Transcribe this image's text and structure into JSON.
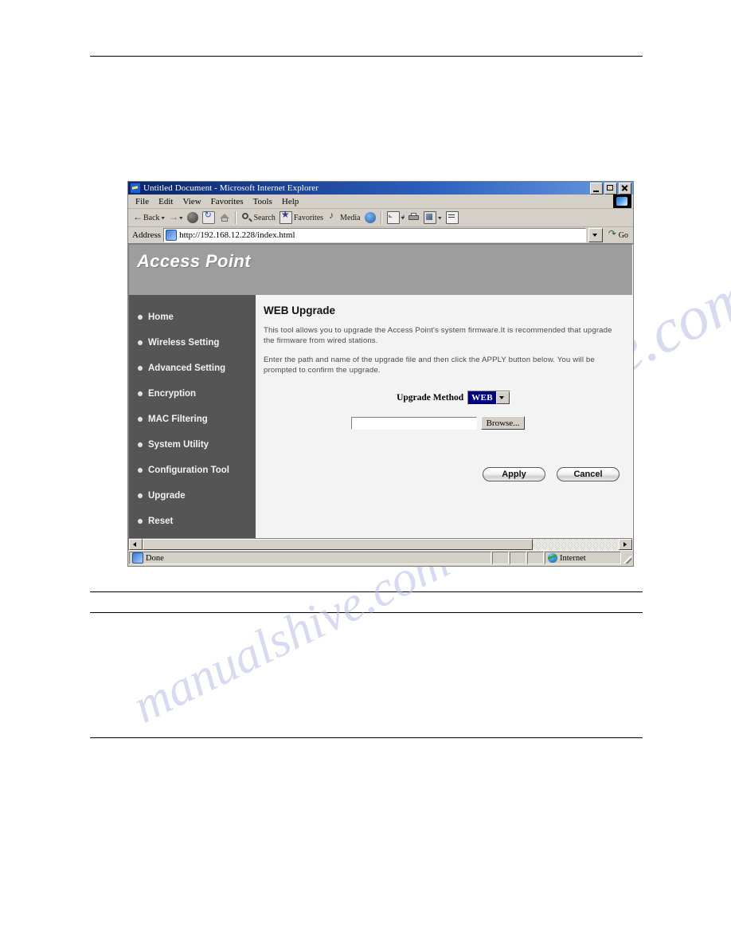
{
  "browser": {
    "title": "Untitled Document - Microsoft Internet Explorer",
    "window_buttons": {
      "minimize": "Minimize",
      "maximize": "Maximize",
      "close": "Close"
    },
    "menu": [
      {
        "label": "File"
      },
      {
        "label": "Edit"
      },
      {
        "label": "View"
      },
      {
        "label": "Favorites"
      },
      {
        "label": "Tools"
      },
      {
        "label": "Help"
      }
    ],
    "toolbar": [
      {
        "label": "Back",
        "icon": "back-arrow-icon",
        "has_dropdown": true
      },
      {
        "label": "",
        "icon": "forward-arrow-icon",
        "has_dropdown": true
      },
      {
        "label": "",
        "icon": "stop-icon",
        "has_dropdown": false
      },
      {
        "label": "",
        "icon": "refresh-icon",
        "has_dropdown": false
      },
      {
        "label": "",
        "icon": "home-icon",
        "has_dropdown": false
      },
      {
        "label": "Search",
        "icon": "search-icon",
        "has_dropdown": false
      },
      {
        "label": "Favorites",
        "icon": "favorites-star-icon",
        "has_dropdown": false
      },
      {
        "label": "Media",
        "icon": "media-note-icon",
        "has_dropdown": false
      },
      {
        "label": "",
        "icon": "history-globe-icon",
        "has_dropdown": false
      },
      {
        "label": "",
        "icon": "mail-icon",
        "has_dropdown": true
      },
      {
        "label": "",
        "icon": "print-icon",
        "has_dropdown": false
      },
      {
        "label": "",
        "icon": "edit-icon",
        "has_dropdown": true
      },
      {
        "label": "",
        "icon": "discuss-icon",
        "has_dropdown": false
      }
    ],
    "address": {
      "label": "Address",
      "value": "http://192.168.12.228/index.html",
      "placeholder": "",
      "go_label": "Go"
    },
    "status": {
      "text": "Done",
      "zone": "Internet"
    }
  },
  "page": {
    "banner_title": "Access Point",
    "sidebar": {
      "items": [
        {
          "label": "Home"
        },
        {
          "label": "Wireless Setting"
        },
        {
          "label": "Advanced Setting"
        },
        {
          "label": "Encryption"
        },
        {
          "label": "MAC Filtering"
        },
        {
          "label": "System Utility"
        },
        {
          "label": "Configuration Tool"
        },
        {
          "label": "Upgrade"
        },
        {
          "label": "Reset"
        }
      ]
    },
    "content": {
      "title": "WEB Upgrade",
      "paragraph_1": "This tool allows you to upgrade the Access Point's system firmware.It is recommended that upgrade the firmware from wired stations.",
      "paragraph_2": "Enter the path and name of the upgrade file and then click the APPLY button below. You will be prompted to confirm the upgrade.",
      "method_label": "Upgrade Method",
      "method_value": "WEB",
      "method_options": [
        "WEB"
      ],
      "file_value": "",
      "file_placeholder": "",
      "browse_label": "Browse...",
      "apply_label": "Apply",
      "cancel_label": "Cancel"
    }
  },
  "watermark": {
    "line_1": "manualshive.com",
    "line_2": "manualshive.com"
  },
  "colors": {
    "titlebar_blue": "#0a246a",
    "chrome_gray": "#d4d0c8",
    "banner_gray": "#9d9d9d",
    "sidebar_gray": "#555555",
    "content_gray": "#f3f3f3",
    "select_highlight": "#000080",
    "watermark": "#b9bce4"
  }
}
